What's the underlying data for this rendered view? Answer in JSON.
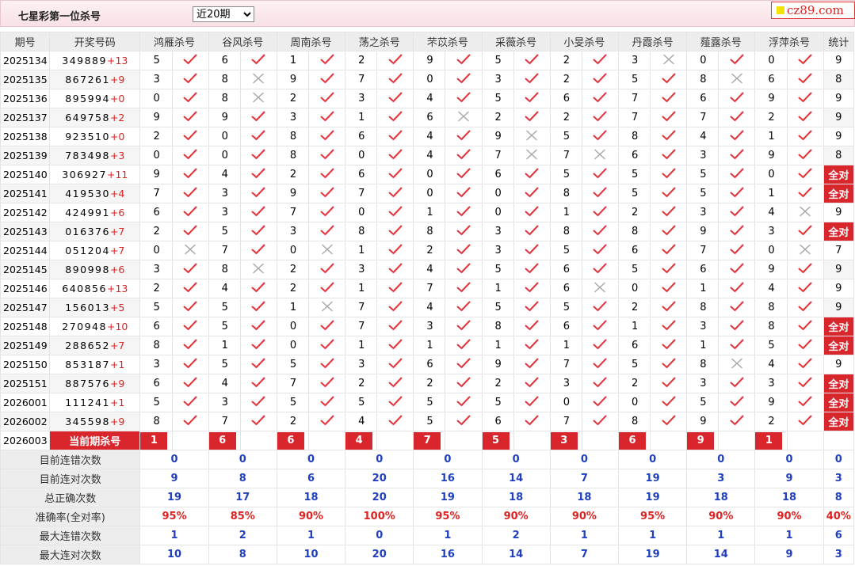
{
  "header": {
    "title": "七星彩第一位杀号",
    "period_select": "近20期",
    "logo": "cz89.com"
  },
  "columns": {
    "issue": "期号",
    "draw": "开奖号码",
    "experts": [
      "鸿雁杀号",
      "谷风杀号",
      "周南杀号",
      "荡之杀号",
      "芣苡杀号",
      "采薇杀号",
      "小旻杀号",
      "丹霞杀号",
      "薤露杀号",
      "浮萍杀号"
    ],
    "stat": "统计"
  },
  "rows": [
    {
      "issue": "2025134",
      "main": "349889",
      "sp": "+13",
      "kills": [
        5,
        6,
        1,
        2,
        9,
        5,
        2,
        3,
        0,
        0
      ],
      "ok": [
        1,
        1,
        1,
        1,
        1,
        1,
        1,
        0,
        1,
        1
      ],
      "stat": "9"
    },
    {
      "issue": "2025135",
      "main": "867261",
      "sp": "+9",
      "kills": [
        3,
        8,
        9,
        7,
        0,
        3,
        2,
        5,
        8,
        6
      ],
      "ok": [
        1,
        0,
        1,
        1,
        1,
        1,
        1,
        1,
        0,
        1
      ],
      "stat": "8"
    },
    {
      "issue": "2025136",
      "main": "895994",
      "sp": "+0",
      "kills": [
        0,
        8,
        2,
        3,
        4,
        5,
        6,
        7,
        6,
        9
      ],
      "ok": [
        1,
        0,
        1,
        1,
        1,
        1,
        1,
        1,
        1,
        1
      ],
      "stat": "9"
    },
    {
      "issue": "2025137",
      "main": "649758",
      "sp": "+2",
      "kills": [
        9,
        9,
        3,
        1,
        6,
        2,
        2,
        7,
        7,
        2
      ],
      "ok": [
        1,
        1,
        1,
        1,
        0,
        1,
        1,
        1,
        1,
        1
      ],
      "stat": "9"
    },
    {
      "issue": "2025138",
      "main": "923510",
      "sp": "+0",
      "kills": [
        2,
        0,
        8,
        6,
        4,
        9,
        5,
        8,
        4,
        1
      ],
      "ok": [
        1,
        1,
        1,
        1,
        1,
        0,
        1,
        1,
        1,
        1
      ],
      "stat": "9"
    },
    {
      "issue": "2025139",
      "main": "783498",
      "sp": "+3",
      "kills": [
        0,
        0,
        8,
        0,
        4,
        7,
        7,
        6,
        3,
        9
      ],
      "ok": [
        1,
        1,
        1,
        1,
        1,
        0,
        0,
        1,
        1,
        1
      ],
      "stat": "8"
    },
    {
      "issue": "2025140",
      "main": "306927",
      "sp": "+11",
      "kills": [
        9,
        4,
        2,
        6,
        0,
        6,
        5,
        5,
        5,
        0
      ],
      "ok": [
        1,
        1,
        1,
        1,
        1,
        1,
        1,
        1,
        1,
        1
      ],
      "stat": "全对"
    },
    {
      "issue": "2025141",
      "main": "419530",
      "sp": "+4",
      "kills": [
        7,
        3,
        9,
        7,
        0,
        0,
        8,
        5,
        5,
        1
      ],
      "ok": [
        1,
        1,
        1,
        1,
        1,
        1,
        1,
        1,
        1,
        1
      ],
      "stat": "全对"
    },
    {
      "issue": "2025142",
      "main": "424991",
      "sp": "+6",
      "kills": [
        6,
        3,
        7,
        0,
        1,
        0,
        1,
        2,
        3,
        4
      ],
      "ok": [
        1,
        1,
        1,
        1,
        1,
        1,
        1,
        1,
        1,
        0
      ],
      "stat": "9"
    },
    {
      "issue": "2025143",
      "main": "016376",
      "sp": "+7",
      "kills": [
        2,
        5,
        3,
        8,
        8,
        3,
        8,
        8,
        9,
        3
      ],
      "ok": [
        1,
        1,
        1,
        1,
        1,
        1,
        1,
        1,
        1,
        1
      ],
      "stat": "全对"
    },
    {
      "issue": "2025144",
      "main": "051204",
      "sp": "+7",
      "kills": [
        0,
        7,
        0,
        1,
        2,
        3,
        5,
        6,
        7,
        0
      ],
      "ok": [
        0,
        1,
        0,
        1,
        1,
        1,
        1,
        1,
        1,
        0
      ],
      "stat": "7"
    },
    {
      "issue": "2025145",
      "main": "890998",
      "sp": "+6",
      "kills": [
        3,
        8,
        2,
        3,
        4,
        5,
        6,
        5,
        6,
        9
      ],
      "ok": [
        1,
        0,
        1,
        1,
        1,
        1,
        1,
        1,
        1,
        1
      ],
      "stat": "9"
    },
    {
      "issue": "2025146",
      "main": "640856",
      "sp": "+13",
      "kills": [
        2,
        4,
        2,
        1,
        7,
        1,
        6,
        0,
        1,
        4
      ],
      "ok": [
        1,
        1,
        1,
        1,
        1,
        1,
        0,
        1,
        1,
        1
      ],
      "stat": "9"
    },
    {
      "issue": "2025147",
      "main": "156013",
      "sp": "+5",
      "kills": [
        5,
        5,
        1,
        7,
        4,
        5,
        5,
        2,
        8,
        8
      ],
      "ok": [
        1,
        1,
        0,
        1,
        1,
        1,
        1,
        1,
        1,
        1
      ],
      "stat": "9"
    },
    {
      "issue": "2025148",
      "main": "270948",
      "sp": "+10",
      "kills": [
        6,
        5,
        0,
        7,
        3,
        8,
        6,
        1,
        3,
        8
      ],
      "ok": [
        1,
        1,
        1,
        1,
        1,
        1,
        1,
        1,
        1,
        1
      ],
      "stat": "全对"
    },
    {
      "issue": "2025149",
      "main": "288652",
      "sp": "+7",
      "kills": [
        8,
        1,
        0,
        1,
        1,
        1,
        1,
        6,
        1,
        5
      ],
      "ok": [
        1,
        1,
        1,
        1,
        1,
        1,
        1,
        1,
        1,
        1
      ],
      "stat": "全对"
    },
    {
      "issue": "2025150",
      "main": "853187",
      "sp": "+1",
      "kills": [
        3,
        5,
        5,
        3,
        6,
        9,
        7,
        5,
        8,
        4
      ],
      "ok": [
        1,
        1,
        1,
        1,
        1,
        1,
        1,
        1,
        0,
        1
      ],
      "stat": "9"
    },
    {
      "issue": "2025151",
      "main": "887576",
      "sp": "+9",
      "kills": [
        6,
        4,
        7,
        2,
        2,
        2,
        3,
        2,
        3,
        3
      ],
      "ok": [
        1,
        1,
        1,
        1,
        1,
        1,
        1,
        1,
        1,
        1
      ],
      "stat": "全对"
    },
    {
      "issue": "2026001",
      "main": "111241",
      "sp": "+1",
      "kills": [
        5,
        3,
        5,
        5,
        5,
        5,
        0,
        0,
        5,
        9
      ],
      "ok": [
        1,
        1,
        1,
        1,
        1,
        1,
        1,
        1,
        1,
        1
      ],
      "stat": "全对"
    },
    {
      "issue": "2026002",
      "main": "345598",
      "sp": "+9",
      "kills": [
        8,
        7,
        2,
        4,
        5,
        6,
        7,
        8,
        9,
        2
      ],
      "ok": [
        1,
        1,
        1,
        1,
        1,
        1,
        1,
        1,
        1,
        1
      ],
      "stat": "全对"
    }
  ],
  "current": {
    "issue": "2026003",
    "label": "当前期杀号",
    "kills": [
      "1",
      "6",
      "6",
      "4",
      "7",
      "5",
      "3",
      "6",
      "9",
      "1"
    ]
  },
  "stats": [
    {
      "label": "目前连错次数",
      "color": "blue",
      "values": [
        "0",
        "0",
        "0",
        "0",
        "0",
        "0",
        "0",
        "0",
        "0",
        "0",
        "0"
      ]
    },
    {
      "label": "目前连对次数",
      "color": "blue",
      "values": [
        "9",
        "8",
        "6",
        "20",
        "16",
        "14",
        "7",
        "19",
        "3",
        "9",
        "3"
      ]
    },
    {
      "label": "总正确次数",
      "color": "blue",
      "values": [
        "19",
        "17",
        "18",
        "20",
        "19",
        "18",
        "18",
        "19",
        "18",
        "18",
        "8"
      ]
    },
    {
      "label": "准确率(全对率)",
      "color": "red",
      "values": [
        "95%",
        "85%",
        "90%",
        "100%",
        "95%",
        "90%",
        "90%",
        "95%",
        "90%",
        "90%",
        "40%"
      ]
    },
    {
      "label": "最大连错次数",
      "color": "blue",
      "values": [
        "1",
        "2",
        "1",
        "0",
        "1",
        "2",
        "1",
        "1",
        "1",
        "1",
        "6"
      ]
    },
    {
      "label": "最大连对次数",
      "color": "blue",
      "values": [
        "10",
        "8",
        "10",
        "20",
        "16",
        "14",
        "7",
        "19",
        "14",
        "9",
        "3"
      ]
    }
  ],
  "icons": {
    "right": "check-icon",
    "wrong": "cross-icon"
  },
  "colors": {
    "accent": "#d8262c",
    "check": "#e8323a",
    "cross": "#a8a8a8",
    "stat_blue": "#1f3fbf",
    "stat_red": "#d22222"
  }
}
